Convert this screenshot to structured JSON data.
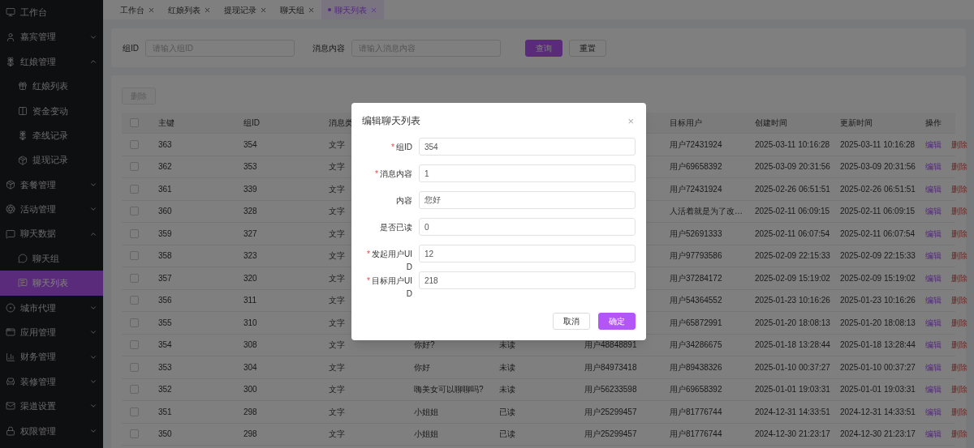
{
  "sidebar": {
    "items": [
      {
        "label": "工作台",
        "selected": false
      },
      {
        "label": "嘉宾管理",
        "expanded": false,
        "selected": false
      },
      {
        "label": "红娘管理",
        "expanded": true,
        "selected": false,
        "children": [
          {
            "label": "红娘列表",
            "selected": false
          },
          {
            "label": "资金变动",
            "selected": false
          },
          {
            "label": "牵线记录",
            "selected": false
          },
          {
            "label": "提现记录",
            "selected": false
          }
        ]
      },
      {
        "label": "套餐管理",
        "expanded": false,
        "selected": false
      },
      {
        "label": "活动管理",
        "expanded": false,
        "selected": false
      },
      {
        "label": "聊天数据",
        "expanded": true,
        "selected": false,
        "children": [
          {
            "label": "聊天组",
            "selected": false
          },
          {
            "label": "聊天列表",
            "selected": true
          }
        ]
      },
      {
        "label": "城市代理",
        "expanded": false,
        "selected": false
      },
      {
        "label": "应用管理",
        "expanded": false,
        "selected": false
      },
      {
        "label": "财务管理",
        "expanded": false,
        "selected": false
      },
      {
        "label": "装修管理",
        "expanded": false,
        "selected": false
      },
      {
        "label": "渠道设置",
        "expanded": false,
        "selected": false
      },
      {
        "label": "权限管理",
        "expanded": false,
        "selected": false
      }
    ]
  },
  "tabs": [
    {
      "label": "工作台",
      "selected": false
    },
    {
      "label": "红娘列表",
      "selected": false
    },
    {
      "label": "提现记录",
      "selected": false
    },
    {
      "label": "聊天组",
      "selected": false
    },
    {
      "label": "聊天列表",
      "selected": true
    }
  ],
  "search": {
    "fields": [
      {
        "label": "组ID",
        "placeholder": "请输入组ID"
      },
      {
        "label": "消息内容",
        "placeholder": "请输入消息内容"
      }
    ],
    "buttons": [
      {
        "label": "查询",
        "kind": "primary"
      },
      {
        "label": "重置",
        "kind": "default"
      }
    ]
  },
  "toolbar": {
    "delete_button": {
      "label": "删除",
      "disabled": true
    }
  },
  "table": {
    "header_checked": false,
    "header": {
      "id": "主键",
      "group_id": "组ID",
      "type": "消息类",
      "target": "目标用户",
      "created": "创建时间",
      "updated": "更新时间",
      "actions": "操作"
    },
    "rows": [
      {
        "checked": false,
        "id": "363",
        "group_id": "354",
        "type": "文字",
        "target": "用户72431924",
        "created": "2025-03-11 10:16:28",
        "updated": "2025-03-11 10:16:28",
        "actions": [
          "编辑",
          "删除"
        ]
      },
      {
        "checked": false,
        "id": "362",
        "group_id": "353",
        "type": "文字",
        "target": "用户69658392",
        "created": "2025-03-09 20:31:56",
        "updated": "2025-03-09 20:31:56",
        "actions": [
          "编辑",
          "删除"
        ]
      },
      {
        "checked": false,
        "id": "361",
        "group_id": "339",
        "type": "文字",
        "target": "用户72431924",
        "created": "2025-02-26 06:51:51",
        "updated": "2025-02-26 06:51:51",
        "actions": [
          "编辑",
          "删除"
        ]
      },
      {
        "checked": false,
        "id": "360",
        "group_id": "328",
        "type": "文字",
        "target": "人活着就是为了改…",
        "created": "2025-02-11 06:09:15",
        "updated": "2025-02-11 06:09:15",
        "actions": [
          "编辑",
          "删除"
        ]
      },
      {
        "checked": false,
        "id": "359",
        "group_id": "327",
        "type": "文字",
        "target": "用户52691333",
        "created": "2025-02-11 06:07:54",
        "updated": "2025-02-11 06:07:54",
        "actions": [
          "编辑",
          "删除"
        ]
      },
      {
        "checked": false,
        "id": "358",
        "group_id": "323",
        "type": "文字",
        "target": "用户97793586",
        "created": "2025-02-09 22:15:33",
        "updated": "2025-02-09 22:15:33",
        "actions": [
          "编辑",
          "删除"
        ]
      },
      {
        "checked": false,
        "id": "357",
        "group_id": "320",
        "type": "文字",
        "target": "用户37284172",
        "created": "2025-02-09 15:19:02",
        "updated": "2025-02-09 15:19:02",
        "actions": [
          "编辑",
          "删除"
        ]
      },
      {
        "checked": false,
        "id": "356",
        "group_id": "311",
        "type": "文字",
        "target": "用户54364552",
        "created": "2025-01-23 10:16:26",
        "updated": "2025-01-23 10:16:26",
        "actions": [
          "编辑",
          "删除"
        ]
      },
      {
        "checked": false,
        "id": "355",
        "group_id": "310",
        "type": "文字",
        "target": "用户65872991",
        "created": "2025-01-20 18:08:13",
        "updated": "2025-01-20 18:08:13",
        "actions": [
          "编辑",
          "删除"
        ]
      },
      {
        "checked": false,
        "id": "354",
        "group_id": "308",
        "type": "文字",
        "content": "你好?",
        "read": "未读",
        "sender": "用户48848891",
        "target": "用户34286675",
        "created": "2025-01-18 13:28:44",
        "updated": "2025-01-18 13:28:44",
        "actions": [
          "编辑",
          "删除"
        ]
      },
      {
        "checked": false,
        "id": "353",
        "group_id": "304",
        "type": "文字",
        "content": "你好",
        "read": "未读",
        "sender": "用户84973418",
        "target": "用户89438326",
        "created": "2025-01-10 00:37:27",
        "updated": "2025-01-10 00:37:27",
        "actions": [
          "编辑",
          "删除"
        ]
      },
      {
        "checked": false,
        "id": "352",
        "group_id": "300",
        "type": "文字",
        "content": "嗨美女可以聊聊吗?",
        "read": "未读",
        "sender": "用户56233598",
        "target": "用户69658392",
        "created": "2025-01-01 19:03:31",
        "updated": "2025-01-01 19:03:31",
        "actions": [
          "编辑",
          "删除"
        ]
      },
      {
        "checked": false,
        "id": "351",
        "group_id": "298",
        "type": "文字",
        "content": "小姐姐",
        "read": "已读",
        "sender": "用户25299457",
        "target": "用户81776744",
        "created": "2024-12-31 14:33:51",
        "updated": "2024-12-31 14:33:51",
        "actions": [
          "编辑",
          "删除"
        ]
      },
      {
        "checked": false,
        "id": "350",
        "group_id": "298",
        "type": "文字",
        "content": "小姐姐",
        "read": "已读",
        "sender": "用户25299457",
        "target": "用户81776744",
        "created": "2024-12-30 21:23:17",
        "updated": "2024-12-30 21:23:17",
        "actions": [
          "编辑",
          "删除"
        ]
      }
    ]
  },
  "dialog": {
    "title": "编辑聊天列表",
    "close": "×",
    "required_mark": "*",
    "fields": [
      {
        "label": "组ID",
        "required": true,
        "value": "354"
      },
      {
        "label": "消息内容",
        "required": true,
        "value": "1"
      },
      {
        "label": "内容",
        "required": false,
        "value": "您好"
      },
      {
        "label": "是否已读",
        "required": false,
        "value": "0"
      },
      {
        "label": "发起用户UID",
        "required": true,
        "value": "12"
      },
      {
        "label": "目标用户UID",
        "required": true,
        "value": "218"
      }
    ],
    "buttons": [
      {
        "label": "取消",
        "kind": "default"
      },
      {
        "label": "确定",
        "kind": "primary"
      }
    ]
  }
}
